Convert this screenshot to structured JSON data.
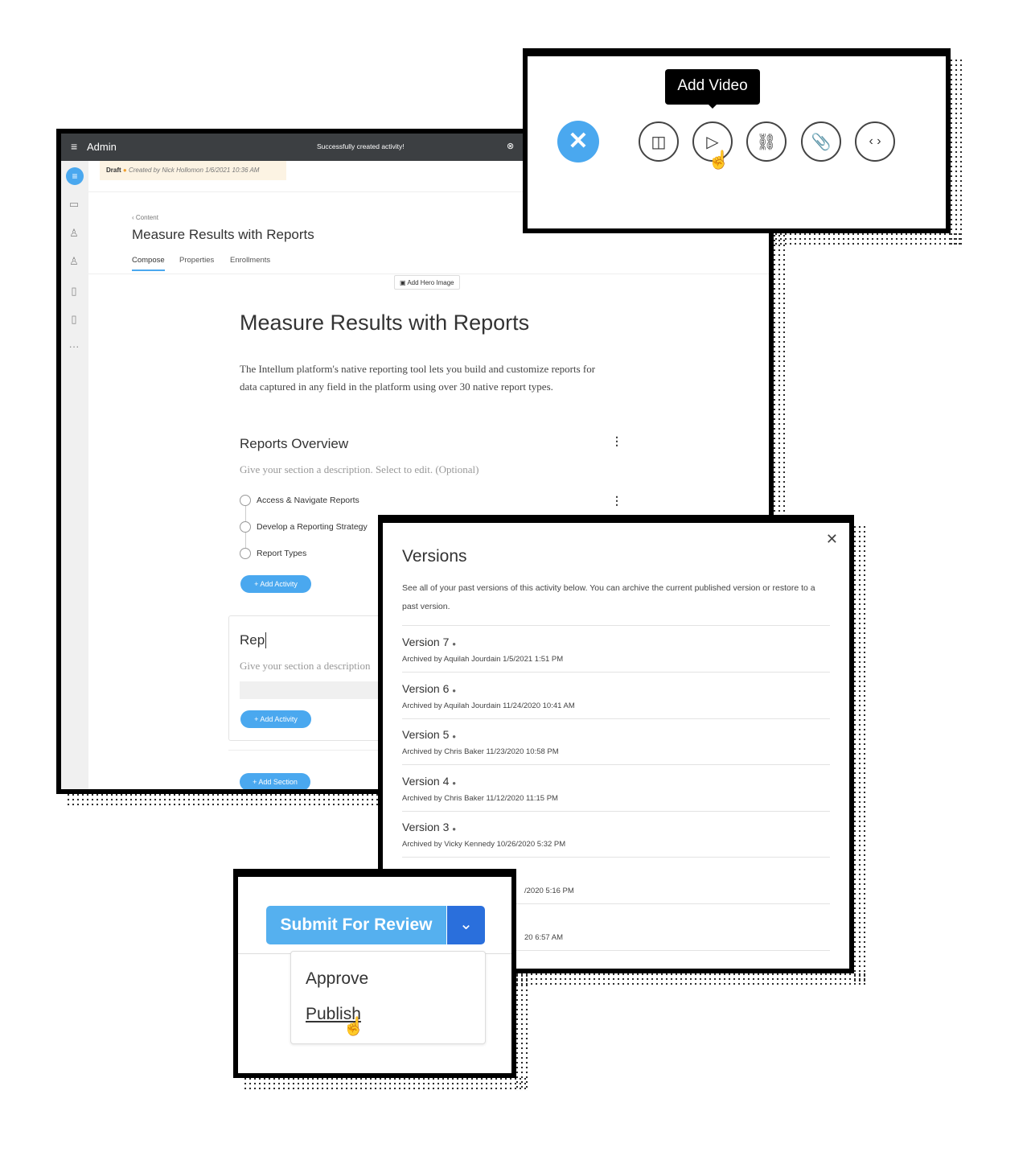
{
  "admin": {
    "app_title": "Admin",
    "toast": "Successfully created activity!",
    "status": "Draft",
    "created": "Created by Nick Hollomon 1/6/2021 10:36 AM",
    "breadcrumb": "Content",
    "page_title": "Measure Results with Reports",
    "tabs": [
      "Compose",
      "Properties",
      "Enrollments"
    ],
    "add_hero": "Add Hero Image",
    "heading": "Measure Results with Reports",
    "intro": "The Intellum platform's native reporting tool lets you build and customize reports for data captured in any field in the platform using over 30 native report types.",
    "section_title": "Reports Overview",
    "section_desc": "Give your section a description. Select to edit. (Optional)",
    "activities": [
      "Access & Navigate Reports",
      "Develop a Reporting Strategy",
      "Report Types"
    ],
    "add_activity": "+ Add Activity",
    "section2_title": "Rep",
    "section2_desc": "Give your section a description",
    "add_section": "+ Add Section",
    "accent": "#4aa8ef"
  },
  "toolbar": {
    "tooltip": "Add Video",
    "icons": [
      "close-icon",
      "camera-icon",
      "play-icon",
      "link-icon",
      "paperclip-icon",
      "code-icon"
    ]
  },
  "versions": {
    "title": "Versions",
    "desc": "See all of your past versions of this activity below. You can archive the current published version or restore to a past version.",
    "items": [
      {
        "label": "Version 7",
        "meta": "Archived by Aquilah Jourdain 1/5/2021 1:51 PM"
      },
      {
        "label": "Version 6",
        "meta": "Archived by Aquilah Jourdain 11/24/2020 10:41 AM"
      },
      {
        "label": "Version 5",
        "meta": "Archived by Chris Baker 11/23/2020 10:58 PM"
      },
      {
        "label": "Version 4",
        "meta": "Archived by Chris Baker 11/12/2020 11:15 PM"
      },
      {
        "label": "Version 3",
        "meta": "Archived by Vicky Kennedy 10/26/2020 5:32 PM"
      },
      {
        "label": "",
        "meta": "/2020 5:16 PM"
      },
      {
        "label": "",
        "meta": "20 6:57 AM"
      }
    ]
  },
  "review": {
    "submit": "Submit For Review",
    "options": [
      "Approve",
      "Publish"
    ]
  }
}
